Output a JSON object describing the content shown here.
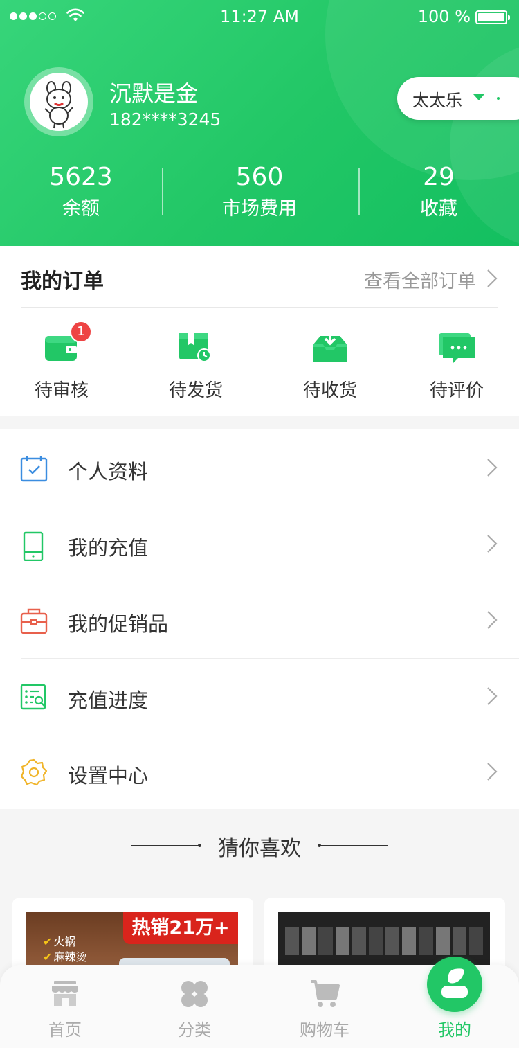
{
  "status_bar": {
    "time": "11:27 AM",
    "battery": "100 %"
  },
  "profile": {
    "name": "沉默是金",
    "phone": "182****3245",
    "store": "太太乐"
  },
  "stats": [
    {
      "value": "5623",
      "label": "余额"
    },
    {
      "value": "560",
      "label": "市场费用"
    },
    {
      "value": "29",
      "label": "收藏"
    }
  ],
  "orders": {
    "title": "我的订单",
    "view_all": "查看全部订单",
    "items": [
      {
        "label": "待审核",
        "icon": "wallet-icon",
        "badge": "1"
      },
      {
        "label": "待发货",
        "icon": "box-clock-icon"
      },
      {
        "label": "待收货",
        "icon": "inbox-download-icon"
      },
      {
        "label": "待评价",
        "icon": "chat-bubble-icon"
      }
    ]
  },
  "menu": [
    {
      "label": "个人资料",
      "icon": "calendar-check-icon",
      "color": "#3b8de0"
    },
    {
      "label": "我的充值",
      "icon": "phone-icon",
      "color": "#22c766"
    },
    {
      "label": "我的促销品",
      "icon": "gift-box-icon",
      "color": "#e8604c"
    },
    {
      "label": "充值进度",
      "icon": "list-search-icon",
      "color": "#22c766"
    },
    {
      "label": "设置中心",
      "icon": "gear-icon",
      "color": "#f0b429"
    }
  ],
  "recommend": {
    "title": "猜你喜欢",
    "card1": {
      "tag": "热销21万+",
      "features": [
        "火锅",
        "麻辣烫"
      ]
    }
  },
  "tabbar": [
    {
      "label": "首页",
      "icon": "store-icon"
    },
    {
      "label": "分类",
      "icon": "category-icon"
    },
    {
      "label": "购物车",
      "icon": "cart-icon"
    },
    {
      "label": "我的",
      "icon": "user-icon",
      "active": true
    }
  ],
  "colors": {
    "primary": "#22c766",
    "badge": "#ee4444"
  }
}
